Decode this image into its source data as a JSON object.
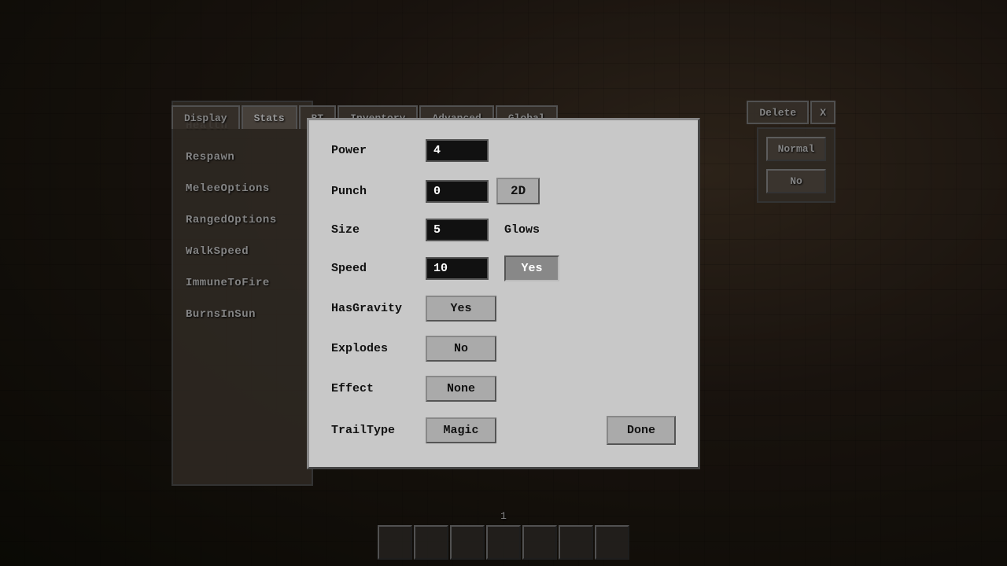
{
  "background": {
    "color": "#1a1a1a"
  },
  "tabs": {
    "items": [
      {
        "id": "display",
        "label": "Display",
        "active": false
      },
      {
        "id": "stats",
        "label": "Stats",
        "active": true
      },
      {
        "id": "bt",
        "label": "BT",
        "active": false
      },
      {
        "id": "inventory",
        "label": "Inventory",
        "active": false
      },
      {
        "id": "advanced",
        "label": "Advanced",
        "active": false
      },
      {
        "id": "global",
        "label": "Global",
        "active": false
      }
    ]
  },
  "top_right": {
    "delete_label": "Delete",
    "close_label": "X"
  },
  "sidebar": {
    "items": [
      {
        "label": "Health"
      },
      {
        "label": "Respawn"
      },
      {
        "label": "MeleeOptions"
      },
      {
        "label": "RangedOptions"
      },
      {
        "label": "WalkSpeed"
      },
      {
        "label": "ImmuneToFire"
      },
      {
        "label": "BurnsInSun"
      }
    ]
  },
  "right_panel": {
    "normal_label": "Normal",
    "no_label": "No"
  },
  "dialog": {
    "power": {
      "label": "Power",
      "value": "4"
    },
    "punch": {
      "label": "Punch",
      "value": "0"
    },
    "punch_btn": {
      "label": "2D"
    },
    "size": {
      "label": "Size",
      "value": "5"
    },
    "glows": {
      "label": "Glows"
    },
    "speed": {
      "label": "Speed",
      "value": "10"
    },
    "glows_btn": {
      "label": "Yes",
      "active": true
    },
    "has_gravity": {
      "label": "HasGravity"
    },
    "has_gravity_btn": {
      "label": "Yes",
      "active": false
    },
    "explodes": {
      "label": "Explodes"
    },
    "explodes_btn": {
      "label": "No",
      "active": false
    },
    "effect": {
      "label": "Effect"
    },
    "effect_btn": {
      "label": "None",
      "active": false
    },
    "trail_type": {
      "label": "TrailType"
    },
    "trail_type_btn": {
      "label": "Magic",
      "active": false
    },
    "done_btn": {
      "label": "Done"
    }
  },
  "hotbar": {
    "number": "1",
    "slots": 7
  }
}
